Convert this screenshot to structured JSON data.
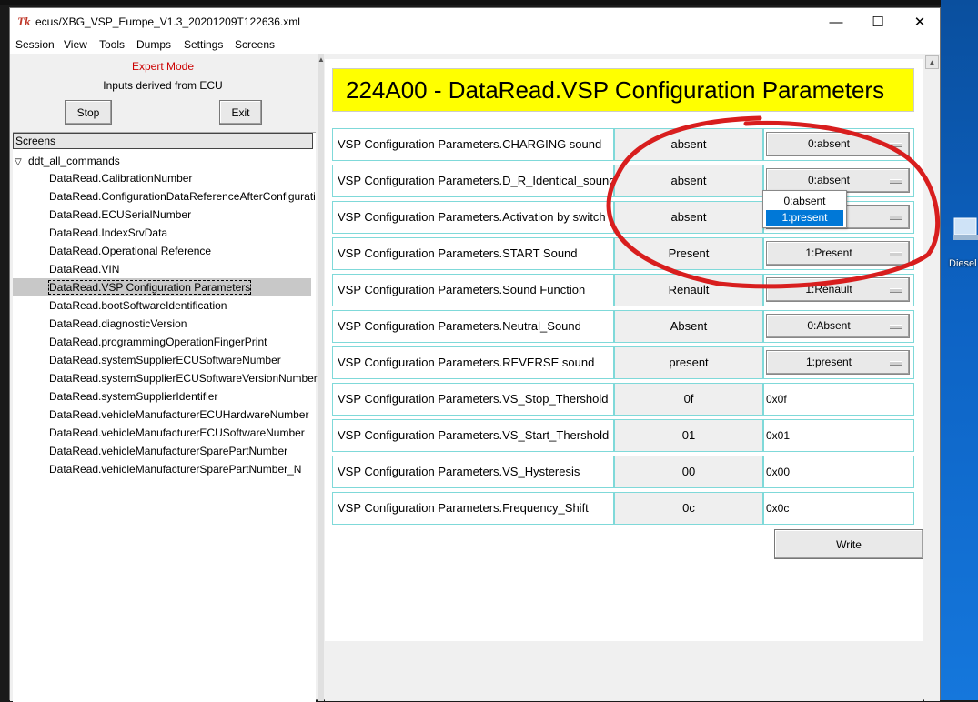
{
  "window": {
    "title": "ecus/XBG_VSP_Europe_V1.3_20201209T122636.xml",
    "app_icon": "tk-feather-icon",
    "minimize_glyph": "—",
    "maximize_glyph": "☐",
    "close_glyph": "✕"
  },
  "menu": [
    "Session",
    "View",
    "Tools",
    "Dumps",
    "Settings",
    "Screens"
  ],
  "left_panel": {
    "mode_label": "Expert Mode",
    "mode_color": "#cc0000",
    "inputs_label": "Inputs derived from ECU",
    "stop_button": "Stop",
    "exit_button": "Exit",
    "tree_header": "Screens",
    "tree_root": "ddt_all_commands",
    "tree_items": [
      "DataRead.CalibrationNumber",
      "DataRead.ConfigurationDataReferenceAfterConfigurati",
      "DataRead.ECUSerialNumber",
      "DataRead.IndexSrvData",
      "DataRead.Operational Reference",
      "DataRead.VIN",
      "DataRead.VSP Configuration Parameters",
      "DataRead.bootSoftwareIdentification",
      "DataRead.diagnosticVersion",
      "DataRead.programmingOperationFingerPrint",
      "DataRead.systemSupplierECUSoftwareNumber",
      "DataRead.systemSupplierECUSoftwareVersionNumber",
      "DataRead.systemSupplierIdentifier",
      "DataRead.vehicleManufacturerECUHardwareNumber",
      "DataRead.vehicleManufacturerECUSoftwareNumber",
      "DataRead.vehicleManufacturerSparePartNumber",
      "DataRead.vehicleManufacturerSparePartNumber_N"
    ],
    "selected_index": 6
  },
  "main": {
    "header": "224A00 - DataRead.VSP Configuration Parameters",
    "header_bg": "#ffff00",
    "rows": [
      {
        "label": "VSP Configuration Parameters.CHARGING sound",
        "value": "absent",
        "kind": "select",
        "selected": "0:absent"
      },
      {
        "label": "VSP Configuration Parameters.D_R_Identical_sound",
        "value": "absent",
        "kind": "select",
        "selected": "0:absent"
      },
      {
        "label": "VSP Configuration Parameters.Activation by switch",
        "value": "absent",
        "kind": "select",
        "selected": ""
      },
      {
        "label": "VSP Configuration Parameters.START Sound",
        "value": "Present",
        "kind": "select",
        "selected": "1:Present"
      },
      {
        "label": "VSP Configuration Parameters.Sound Function",
        "value": "Renault",
        "kind": "select",
        "selected": "1:Renault"
      },
      {
        "label": "VSP Configuration Parameters.Neutral_Sound",
        "value": "Absent",
        "kind": "select",
        "selected": "0:Absent"
      },
      {
        "label": "VSP Configuration Parameters.REVERSE sound",
        "value": "present",
        "kind": "select",
        "selected": "1:present"
      },
      {
        "label": "VSP Configuration Parameters.VS_Stop_Thershold",
        "value": "0f",
        "kind": "entry",
        "selected": "0x0f"
      },
      {
        "label": "VSP Configuration Parameters.VS_Start_Thershold",
        "value": "01",
        "kind": "entry",
        "selected": "0x01"
      },
      {
        "label": "VSP Configuration Parameters.VS_Hysteresis",
        "value": "00",
        "kind": "entry",
        "selected": "0x00"
      },
      {
        "label": "VSP Configuration Parameters.Frequency_Shift",
        "value": "0c",
        "kind": "entry",
        "selected": "0x0c"
      }
    ],
    "write_button": "Write",
    "open_dropdown": {
      "options": [
        "0:absent",
        "1:present"
      ],
      "highlighted": "1:present"
    },
    "annotation_color": "#d81e1e"
  },
  "desktop": {
    "icon_label": "Diesel"
  }
}
